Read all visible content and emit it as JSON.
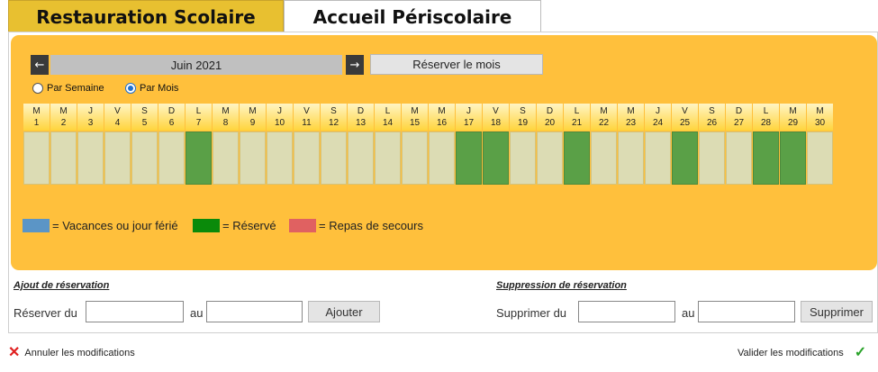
{
  "tabs": [
    {
      "label": "Restauration Scolaire",
      "active": true
    },
    {
      "label": "Accueil Périscolaire",
      "active": false
    }
  ],
  "calendar": {
    "month_label": "Juin 2021",
    "prev_icon": "←",
    "next_icon": "→",
    "reserve_month_label": "Réserver le mois",
    "view_options": [
      {
        "label": "Par Semaine",
        "checked": false
      },
      {
        "label": "Par Mois",
        "checked": true
      }
    ],
    "days": [
      {
        "letter": "M",
        "num": "1",
        "status": "free"
      },
      {
        "letter": "M",
        "num": "2",
        "status": "free"
      },
      {
        "letter": "J",
        "num": "3",
        "status": "free"
      },
      {
        "letter": "V",
        "num": "4",
        "status": "free"
      },
      {
        "letter": "S",
        "num": "5",
        "status": "free"
      },
      {
        "letter": "D",
        "num": "6",
        "status": "free"
      },
      {
        "letter": "L",
        "num": "7",
        "status": "reserved"
      },
      {
        "letter": "M",
        "num": "8",
        "status": "free"
      },
      {
        "letter": "M",
        "num": "9",
        "status": "free"
      },
      {
        "letter": "J",
        "num": "10",
        "status": "free"
      },
      {
        "letter": "V",
        "num": "11",
        "status": "free"
      },
      {
        "letter": "S",
        "num": "12",
        "status": "free"
      },
      {
        "letter": "D",
        "num": "13",
        "status": "free"
      },
      {
        "letter": "L",
        "num": "14",
        "status": "free"
      },
      {
        "letter": "M",
        "num": "15",
        "status": "free"
      },
      {
        "letter": "M",
        "num": "16",
        "status": "free"
      },
      {
        "letter": "J",
        "num": "17",
        "status": "reserved"
      },
      {
        "letter": "V",
        "num": "18",
        "status": "reserved"
      },
      {
        "letter": "S",
        "num": "19",
        "status": "free"
      },
      {
        "letter": "D",
        "num": "20",
        "status": "free"
      },
      {
        "letter": "L",
        "num": "21",
        "status": "reserved"
      },
      {
        "letter": "M",
        "num": "22",
        "status": "free"
      },
      {
        "letter": "M",
        "num": "23",
        "status": "free"
      },
      {
        "letter": "J",
        "num": "24",
        "status": "free"
      },
      {
        "letter": "V",
        "num": "25",
        "status": "reserved"
      },
      {
        "letter": "S",
        "num": "26",
        "status": "free"
      },
      {
        "letter": "D",
        "num": "27",
        "status": "free"
      },
      {
        "letter": "L",
        "num": "28",
        "status": "reserved"
      },
      {
        "letter": "M",
        "num": "29",
        "status": "reserved"
      },
      {
        "letter": "M",
        "num": "30",
        "status": "free"
      }
    ]
  },
  "legend": [
    {
      "label": "= Vacances ou jour férié",
      "color": "#5b95c6"
    },
    {
      "label": "= Réservé",
      "color": "#0a8a0a"
    },
    {
      "label": "= Repas de secours",
      "color": "#e06161"
    }
  ],
  "add_reservation": {
    "title": "Ajout de réservation",
    "from_label": "Réserver du",
    "to_label": "au",
    "from_value": "",
    "to_value": "",
    "button_label": "Ajouter"
  },
  "remove_reservation": {
    "title": "Suppression de réservation",
    "from_label": "Supprimer du",
    "to_label": "au",
    "from_value": "",
    "to_value": "",
    "button_label": "Supprimer"
  },
  "footer": {
    "cancel_label": "Annuler les modifications",
    "cancel_icon": "✕",
    "validate_label": "Valider les modifications",
    "validate_icon": "✓"
  }
}
